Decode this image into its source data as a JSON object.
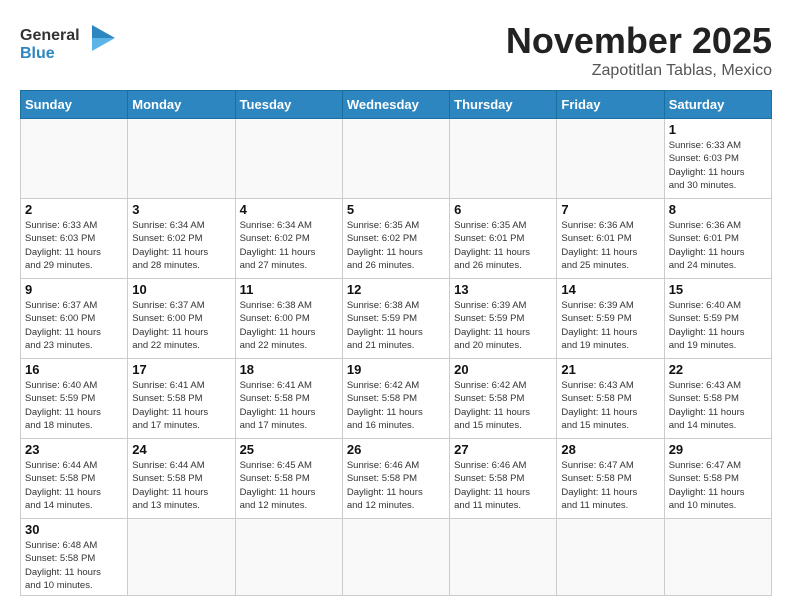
{
  "header": {
    "logo_general": "General",
    "logo_blue": "Blue",
    "month_title": "November 2025",
    "subtitle": "Zapotitlan Tablas, Mexico"
  },
  "days_of_week": [
    "Sunday",
    "Monday",
    "Tuesday",
    "Wednesday",
    "Thursday",
    "Friday",
    "Saturday"
  ],
  "weeks": [
    [
      {
        "day": null,
        "info": null
      },
      {
        "day": null,
        "info": null
      },
      {
        "day": null,
        "info": null
      },
      {
        "day": null,
        "info": null
      },
      {
        "day": null,
        "info": null
      },
      {
        "day": null,
        "info": null
      },
      {
        "day": "1",
        "info": "Sunrise: 6:33 AM\nSunset: 6:03 PM\nDaylight: 11 hours\nand 30 minutes."
      }
    ],
    [
      {
        "day": "2",
        "info": "Sunrise: 6:33 AM\nSunset: 6:03 PM\nDaylight: 11 hours\nand 29 minutes."
      },
      {
        "day": "3",
        "info": "Sunrise: 6:34 AM\nSunset: 6:02 PM\nDaylight: 11 hours\nand 28 minutes."
      },
      {
        "day": "4",
        "info": "Sunrise: 6:34 AM\nSunset: 6:02 PM\nDaylight: 11 hours\nand 27 minutes."
      },
      {
        "day": "5",
        "info": "Sunrise: 6:35 AM\nSunset: 6:02 PM\nDaylight: 11 hours\nand 26 minutes."
      },
      {
        "day": "6",
        "info": "Sunrise: 6:35 AM\nSunset: 6:01 PM\nDaylight: 11 hours\nand 26 minutes."
      },
      {
        "day": "7",
        "info": "Sunrise: 6:36 AM\nSunset: 6:01 PM\nDaylight: 11 hours\nand 25 minutes."
      },
      {
        "day": "8",
        "info": "Sunrise: 6:36 AM\nSunset: 6:01 PM\nDaylight: 11 hours\nand 24 minutes."
      }
    ],
    [
      {
        "day": "9",
        "info": "Sunrise: 6:37 AM\nSunset: 6:00 PM\nDaylight: 11 hours\nand 23 minutes."
      },
      {
        "day": "10",
        "info": "Sunrise: 6:37 AM\nSunset: 6:00 PM\nDaylight: 11 hours\nand 22 minutes."
      },
      {
        "day": "11",
        "info": "Sunrise: 6:38 AM\nSunset: 6:00 PM\nDaylight: 11 hours\nand 22 minutes."
      },
      {
        "day": "12",
        "info": "Sunrise: 6:38 AM\nSunset: 5:59 PM\nDaylight: 11 hours\nand 21 minutes."
      },
      {
        "day": "13",
        "info": "Sunrise: 6:39 AM\nSunset: 5:59 PM\nDaylight: 11 hours\nand 20 minutes."
      },
      {
        "day": "14",
        "info": "Sunrise: 6:39 AM\nSunset: 5:59 PM\nDaylight: 11 hours\nand 19 minutes."
      },
      {
        "day": "15",
        "info": "Sunrise: 6:40 AM\nSunset: 5:59 PM\nDaylight: 11 hours\nand 19 minutes."
      }
    ],
    [
      {
        "day": "16",
        "info": "Sunrise: 6:40 AM\nSunset: 5:59 PM\nDaylight: 11 hours\nand 18 minutes."
      },
      {
        "day": "17",
        "info": "Sunrise: 6:41 AM\nSunset: 5:58 PM\nDaylight: 11 hours\nand 17 minutes."
      },
      {
        "day": "18",
        "info": "Sunrise: 6:41 AM\nSunset: 5:58 PM\nDaylight: 11 hours\nand 17 minutes."
      },
      {
        "day": "19",
        "info": "Sunrise: 6:42 AM\nSunset: 5:58 PM\nDaylight: 11 hours\nand 16 minutes."
      },
      {
        "day": "20",
        "info": "Sunrise: 6:42 AM\nSunset: 5:58 PM\nDaylight: 11 hours\nand 15 minutes."
      },
      {
        "day": "21",
        "info": "Sunrise: 6:43 AM\nSunset: 5:58 PM\nDaylight: 11 hours\nand 15 minutes."
      },
      {
        "day": "22",
        "info": "Sunrise: 6:43 AM\nSunset: 5:58 PM\nDaylight: 11 hours\nand 14 minutes."
      }
    ],
    [
      {
        "day": "23",
        "info": "Sunrise: 6:44 AM\nSunset: 5:58 PM\nDaylight: 11 hours\nand 14 minutes."
      },
      {
        "day": "24",
        "info": "Sunrise: 6:44 AM\nSunset: 5:58 PM\nDaylight: 11 hours\nand 13 minutes."
      },
      {
        "day": "25",
        "info": "Sunrise: 6:45 AM\nSunset: 5:58 PM\nDaylight: 11 hours\nand 12 minutes."
      },
      {
        "day": "26",
        "info": "Sunrise: 6:46 AM\nSunset: 5:58 PM\nDaylight: 11 hours\nand 12 minutes."
      },
      {
        "day": "27",
        "info": "Sunrise: 6:46 AM\nSunset: 5:58 PM\nDaylight: 11 hours\nand 11 minutes."
      },
      {
        "day": "28",
        "info": "Sunrise: 6:47 AM\nSunset: 5:58 PM\nDaylight: 11 hours\nand 11 minutes."
      },
      {
        "day": "29",
        "info": "Sunrise: 6:47 AM\nSunset: 5:58 PM\nDaylight: 11 hours\nand 10 minutes."
      }
    ],
    [
      {
        "day": "30",
        "info": "Sunrise: 6:48 AM\nSunset: 5:58 PM\nDaylight: 11 hours\nand 10 minutes."
      },
      {
        "day": null,
        "info": null
      },
      {
        "day": null,
        "info": null
      },
      {
        "day": null,
        "info": null
      },
      {
        "day": null,
        "info": null
      },
      {
        "day": null,
        "info": null
      },
      {
        "day": null,
        "info": null
      }
    ]
  ]
}
